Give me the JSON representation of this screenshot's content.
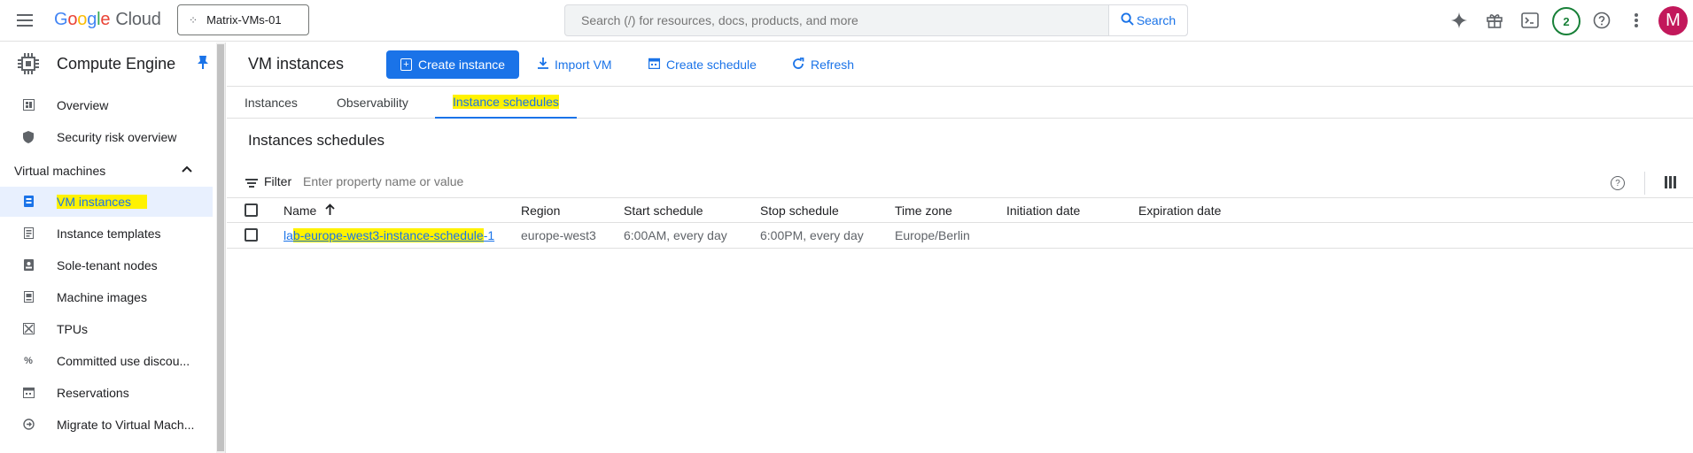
{
  "topbar": {
    "product_prefix": "Google",
    "product_name": "Cloud",
    "project": "Matrix-VMs-01",
    "search_placeholder": "Search (/) for resources, docs, products, and more",
    "search_button": "Search",
    "notification_count": "2",
    "avatar_initial": "M"
  },
  "sidebar": {
    "title": "Compute Engine",
    "items_top": [
      {
        "label": "Overview",
        "icon": "dashboard-icon"
      },
      {
        "label": "Security risk overview",
        "icon": "shield-icon"
      }
    ],
    "section": "Virtual machines",
    "items": [
      {
        "label": "VM instances",
        "icon": "vm-icon",
        "active": true
      },
      {
        "label": "Instance templates",
        "icon": "template-icon"
      },
      {
        "label": "Sole-tenant nodes",
        "icon": "node-icon"
      },
      {
        "label": "Machine images",
        "icon": "image-icon"
      },
      {
        "label": "TPUs",
        "icon": "tpu-icon"
      },
      {
        "label": "Committed use discou...",
        "icon": "percent-icon"
      },
      {
        "label": "Reservations",
        "icon": "calendar-icon"
      },
      {
        "label": "Migrate to Virtual Mach...",
        "icon": "migrate-icon"
      }
    ]
  },
  "main": {
    "title": "VM instances",
    "actions": {
      "create": "Create instance",
      "import": "Import VM",
      "schedule": "Create schedule",
      "refresh": "Refresh"
    },
    "tabs": [
      "Instances",
      "Observability",
      "Instance schedules"
    ],
    "active_tab": "Instance schedules",
    "section_title": "Instances schedules",
    "filter_label": "Filter",
    "filter_placeholder": "Enter property name or value",
    "table": {
      "columns": [
        "Name",
        "Region",
        "Start schedule",
        "Stop schedule",
        "Time zone",
        "Initiation date",
        "Expiration date"
      ],
      "rows": [
        {
          "name_prefix": "la",
          "name_highlight": "b-europe-west3-instance-schedule",
          "name_suffix": "-1",
          "region": "europe-west3",
          "start": "6:00AM, every day",
          "stop": "6:00PM, every day",
          "timezone": "Europe/Berlin",
          "initiation": "",
          "expiration": ""
        }
      ]
    }
  }
}
